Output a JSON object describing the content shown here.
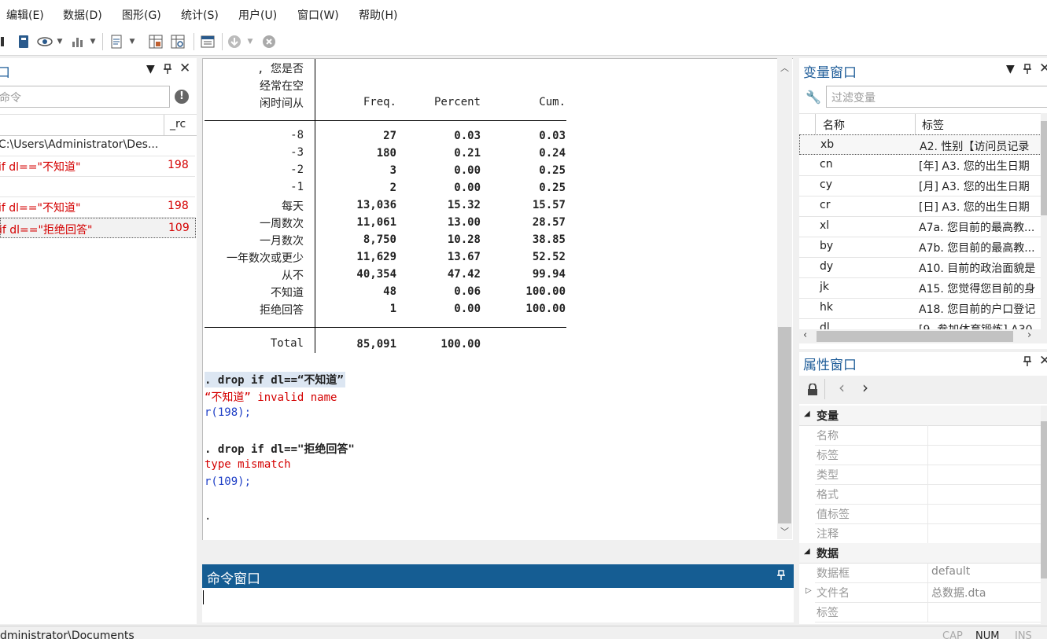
{
  "menu": [
    "编辑(E)",
    "数据(D)",
    "图形(G)",
    "统计(S)",
    "用户(U)",
    "窗口(W)",
    "帮助(H)"
  ],
  "history": {
    "title": "口",
    "search_placeholder": "命令",
    "col_rc": "_rc",
    "items": [
      {
        "text": "C:\\Users\\Administrator\\Des...",
        "rc": "",
        "error": false
      },
      {
        "text": "if dl==\"不知道\"",
        "rc": "198",
        "error": true
      },
      {
        "text": "",
        "rc": "",
        "error": false
      },
      {
        "text": "if dl==\"不知道\"",
        "rc": "198",
        "error": true
      },
      {
        "text": " if dl==\"拒绝回答\"",
        "rc": "109",
        "error": true
      }
    ]
  },
  "results": {
    "header_label": [
      ",  您是否",
      "经常在空",
      "闲时间从"
    ],
    "col_freq": "Freq.",
    "col_percent": "Percent",
    "col_cum": "Cum.",
    "rows": [
      {
        "label": "-8",
        "freq": "27",
        "percent": "0.03",
        "cum": "0.03"
      },
      {
        "label": "-3",
        "freq": "180",
        "percent": "0.21",
        "cum": "0.24"
      },
      {
        "label": "-2",
        "freq": "3",
        "percent": "0.00",
        "cum": "0.25"
      },
      {
        "label": "-1",
        "freq": "2",
        "percent": "0.00",
        "cum": "0.25"
      },
      {
        "label": "每天",
        "freq": "13,036",
        "percent": "15.32",
        "cum": "15.57"
      },
      {
        "label": "一周数次",
        "freq": "11,061",
        "percent": "13.00",
        "cum": "28.57"
      },
      {
        "label": "一月数次",
        "freq": "8,750",
        "percent": "10.28",
        "cum": "38.85"
      },
      {
        "label": "一年数次或更少",
        "freq": "11,629",
        "percent": "13.67",
        "cum": "52.52"
      },
      {
        "label": "从不",
        "freq": "40,354",
        "percent": "47.42",
        "cum": "99.94"
      },
      {
        "label": "不知道",
        "freq": "48",
        "percent": "0.06",
        "cum": "100.00"
      },
      {
        "label": "拒绝回答",
        "freq": "1",
        "percent": "0.00",
        "cum": "100.00"
      }
    ],
    "total_label": "Total",
    "total_freq": "85,091",
    "total_percent": "100.00",
    "cmd1": ". drop if dl==“不知道”",
    "err1": "“不知道” invalid name",
    "rc1": "r(198);",
    "cmd2": ".  drop if dl==\"拒绝回答\"",
    "err2": "type mismatch",
    "rc2": "r(109);",
    "prompt": "."
  },
  "command": {
    "title": "命令窗口"
  },
  "variables": {
    "title": "变量窗口",
    "filter_placeholder": "过滤变量",
    "col_name": "名称",
    "col_label": "标签",
    "rows": [
      {
        "name": "xb",
        "label": "A2. 性别【访问员记录"
      },
      {
        "name": "cn",
        "label": "[年] A3. 您的出生日期"
      },
      {
        "name": "cy",
        "label": "[月] A3. 您的出生日期"
      },
      {
        "name": "cr",
        "label": "[日] A3. 您的出生日期"
      },
      {
        "name": "xl",
        "label": "A7a. 您目前的最高教..."
      },
      {
        "name": "by",
        "label": "A7b. 您目前的最高教..."
      },
      {
        "name": "dy",
        "label": "A10. 目前的政治面貌是"
      },
      {
        "name": "jk",
        "label": "A15. 您觉得您目前的身"
      },
      {
        "name": "hk",
        "label": "A18. 您目前的户口登记"
      },
      {
        "name": "dl",
        "label": "[9. 参加体育锻炼] A30"
      }
    ]
  },
  "properties": {
    "title": "属性窗口",
    "group_var": "变量",
    "var_fields": [
      "名称",
      "标签",
      "类型",
      "格式",
      "值标签",
      "注释"
    ],
    "group_data": "数据",
    "data_fields": [
      {
        "k": "数据框",
        "v": "default"
      },
      {
        "k": "文件名",
        "v": "总数据.dta"
      },
      {
        "k": "标签",
        "v": ""
      }
    ]
  },
  "status": {
    "path": "dministrator\\Documents",
    "cap": "CAP",
    "num": "NUM",
    "ins": "INS"
  }
}
